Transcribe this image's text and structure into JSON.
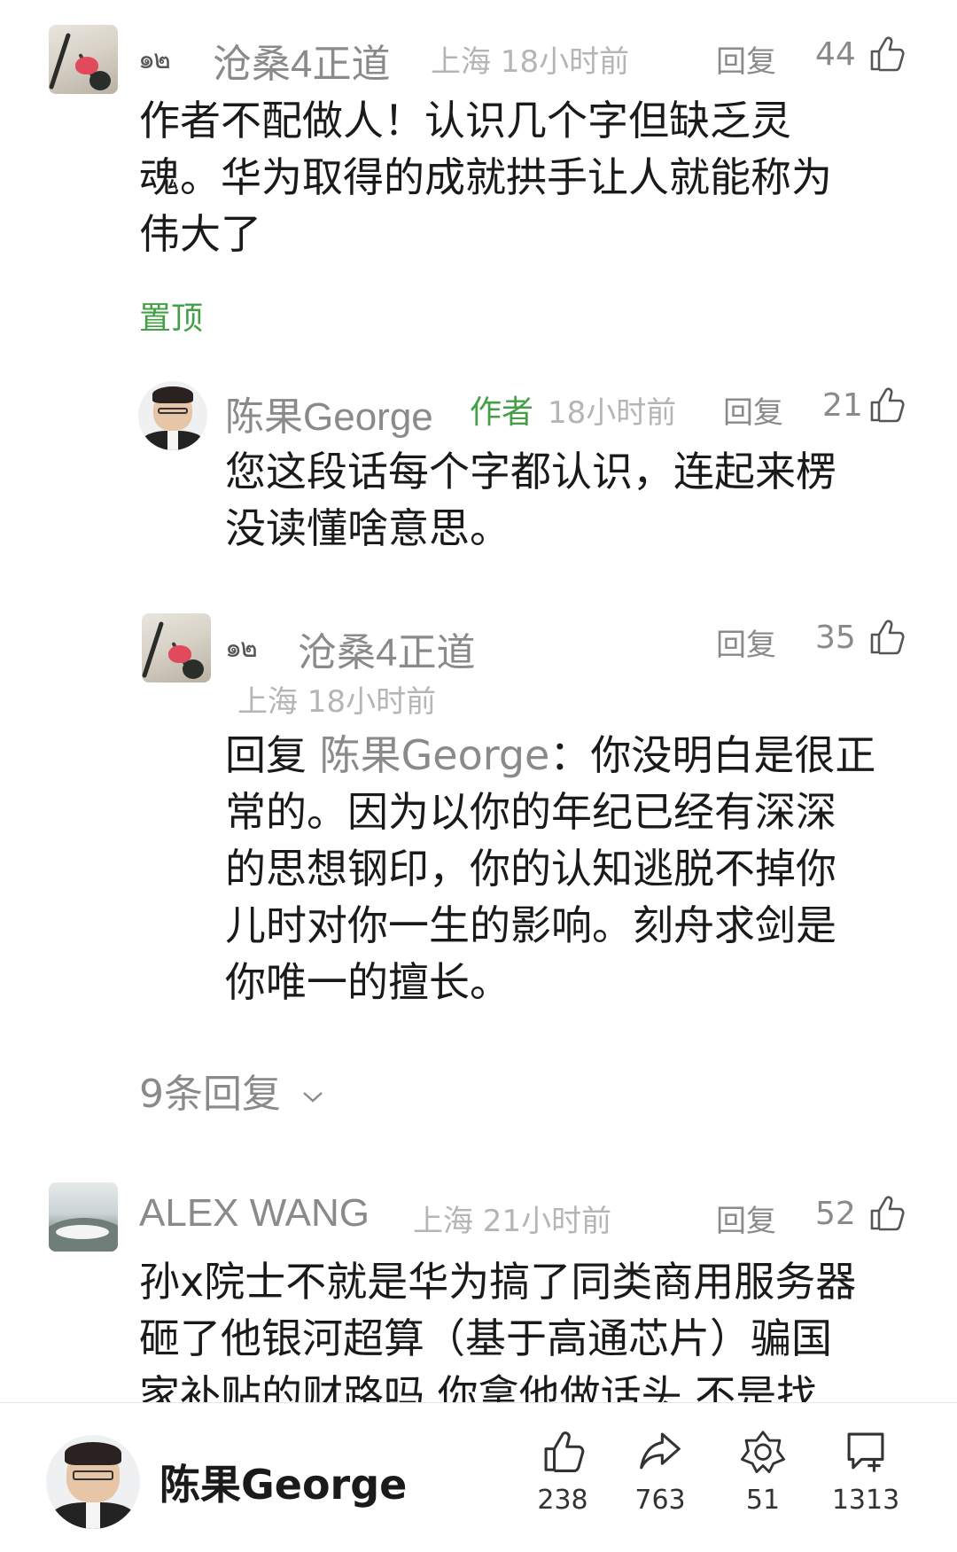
{
  "comments": [
    {
      "user": "沧桑4正道",
      "badge": "๑๒",
      "location_time": "上海 18小时前",
      "reply_label": "回复",
      "likes": "44",
      "text": "作者不配做人！认识几个字但缺乏灵\n魂。华为取得的成就拱手让人就能称为\n伟大了",
      "pinned_label": "置顶"
    },
    {
      "user": "陈果George",
      "author_tag": "作者",
      "time": "18小时前",
      "reply_label": "回复",
      "likes": "21",
      "text": "您这段话每个字都认识，连起来楞\n没读懂啥意思。"
    },
    {
      "user": "沧桑4正道",
      "badge": "๑๒",
      "location_time": "上海 18小时前",
      "reply_label": "回复",
      "likes": "35",
      "reply_prefix": "回复 ",
      "reply_target": "陈果George",
      "text": "：你没明白是很正\n常的。因为以你的年纪已经有深深\n的思想钢印，你的认知逃脱不掉你\n儿时对你一生的影响。刻舟求剑是\n你唯一的擅长。"
    },
    {
      "user": "ALEX WANG",
      "location_time": "上海 21小时前",
      "reply_label": "回复",
      "likes": "52",
      "text": "孙x院士不就是华为搞了同类商用服务器\n砸了他银河超算（基于高通芯片）骗国\n家补贴的财路吗  你拿他做话头  不是找"
    }
  ],
  "more_replies": "9条回复",
  "bottom_bar": {
    "author_name": "陈果George",
    "likes": "238",
    "shares": "763",
    "favorites": "51",
    "comments": "1313"
  },
  "colors": {
    "accent_green": "#43a047",
    "meta_gray": "#b5b5b5",
    "text": "#1a1a1a"
  }
}
